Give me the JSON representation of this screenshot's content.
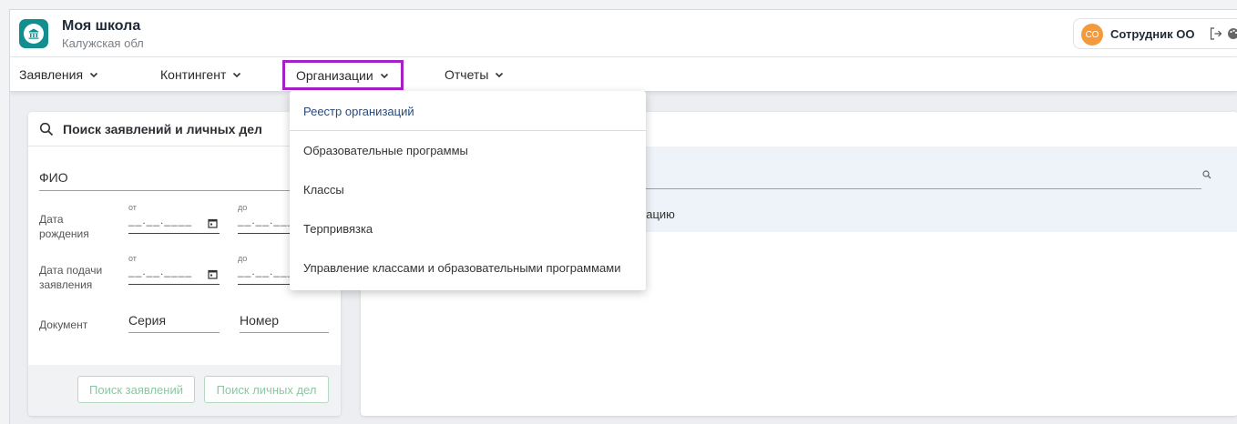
{
  "app": {
    "title": "Моя школа",
    "region": "Калужская обл"
  },
  "user": {
    "initials": "СО",
    "name": "Сотрудник ОО"
  },
  "nav": {
    "items": [
      {
        "label": "Заявления"
      },
      {
        "label": "Контингент"
      },
      {
        "label": "Организации"
      },
      {
        "label": "Отчеты"
      }
    ]
  },
  "dropdown": {
    "items": [
      {
        "label": "Реестр организаций"
      },
      {
        "label": "Образовательные программы"
      },
      {
        "label": "Классы"
      },
      {
        "label": "Терпривязка"
      },
      {
        "label": "Управление классами и образовательными программами"
      }
    ]
  },
  "search": {
    "title": "Поиск заявлений и личных дел",
    "fio_label": "ФИО",
    "birth_label": "Дата рождения",
    "submit_label": "Дата подачи заявления",
    "from": "от",
    "to": "до",
    "date_placeholder": "__.__.____",
    "document_label": "Документ",
    "series_placeholder": "Серия",
    "number_placeholder": "Номер",
    "btn_applications": "Поиск заявлений",
    "btn_personal": "Поиск личных дел"
  },
  "right": {
    "hint_fragment": "изацию"
  },
  "colors": {
    "accent": "#138e8e",
    "highlight": "#a61fc7",
    "avatar": "#f29a3c"
  }
}
